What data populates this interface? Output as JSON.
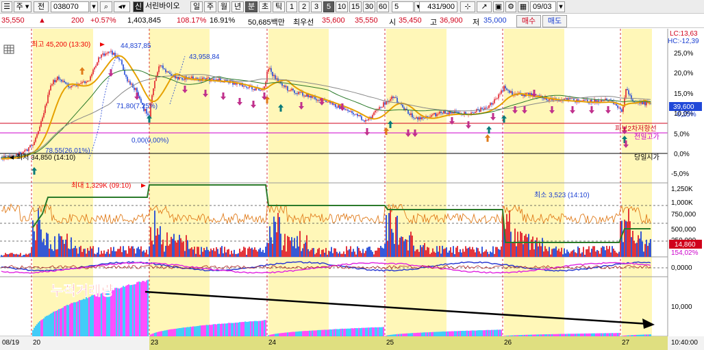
{
  "toolbar": {
    "market_sel": "주",
    "prev_btn": "전",
    "code": "038070",
    "stock_tag": "신",
    "stock_name": "서린바이오",
    "periods": [
      "일",
      "주",
      "월",
      "년",
      "분",
      "초",
      "틱"
    ],
    "period_selected": "분",
    "intervals": [
      "1",
      "2",
      "3",
      "5",
      "10",
      "15",
      "30",
      "60"
    ],
    "interval_selected": "5",
    "interval_value": "5",
    "count": "431/900",
    "date": "09/03"
  },
  "quote": {
    "price": "35,550",
    "change": "200",
    "change_pct": "+0.57%",
    "volume": "1,403,845",
    "volume_ratio": "108.17%",
    "turnover": "16.91%",
    "amount": "50,685백만",
    "best_ask_label": "최우선",
    "best_ask": "35,600",
    "best_bid": "35,550",
    "open_label": "시",
    "open": "35,450",
    "high_label": "고",
    "high": "36,900",
    "low_label": "저",
    "low": "35,000",
    "buy_btn": "매수",
    "sell_btn": "매도"
  },
  "annotations": {
    "high_label": "최고 45,200 (13:30)",
    "high_peak": "44,837,85",
    "peak2": "43,958,84",
    "mid_label": "71,80(7.25%)",
    "mid_label2": "78,55(26,01%)",
    "zero_label": "0,00(0,00%)",
    "low_label": "최저 34,850 (14:10)",
    "vol_max": "최대 1,329K (09:10)",
    "vol_min": "최소 3,523 (14:10)",
    "fib_label": "피보2차저항선",
    "prevhigh_label": "전일고가",
    "open_line_label": "당일시가",
    "cum_volume_label": "누적거래량"
  },
  "right_axis": {
    "lc": "LC:13,63",
    "hc": "HC:-12,39",
    "price_ticks": [
      "25,0%",
      "20,0%",
      "15,0%",
      "10,0%",
      "5,0%",
      "0,0%",
      "-5,0%"
    ],
    "current_box": "39,600",
    "current_pct": "-0,25%",
    "vol_ticks": [
      "1,250K",
      "1,000K",
      "750,000",
      "500,000",
      "250,000"
    ],
    "vol_current": "14,860",
    "vol_pct": "154,02%",
    "osc_tick": "0,0000",
    "cum_tick": "10,000"
  },
  "time_axis": {
    "labels": [
      "08/19",
      "20",
      "23",
      "24",
      "25",
      "26",
      "27"
    ],
    "clock": "10:40:00"
  },
  "colors": {
    "up": "#e0202a",
    "down": "#2048d8",
    "ma_short": "#e6a100",
    "ma_long": "#2a7a2a",
    "highlight": "#fff7b8",
    "cum_magenta": "#ff3cff",
    "cum_cyan": "#2ec8ff",
    "annotation_red": "#ff1010"
  }
}
